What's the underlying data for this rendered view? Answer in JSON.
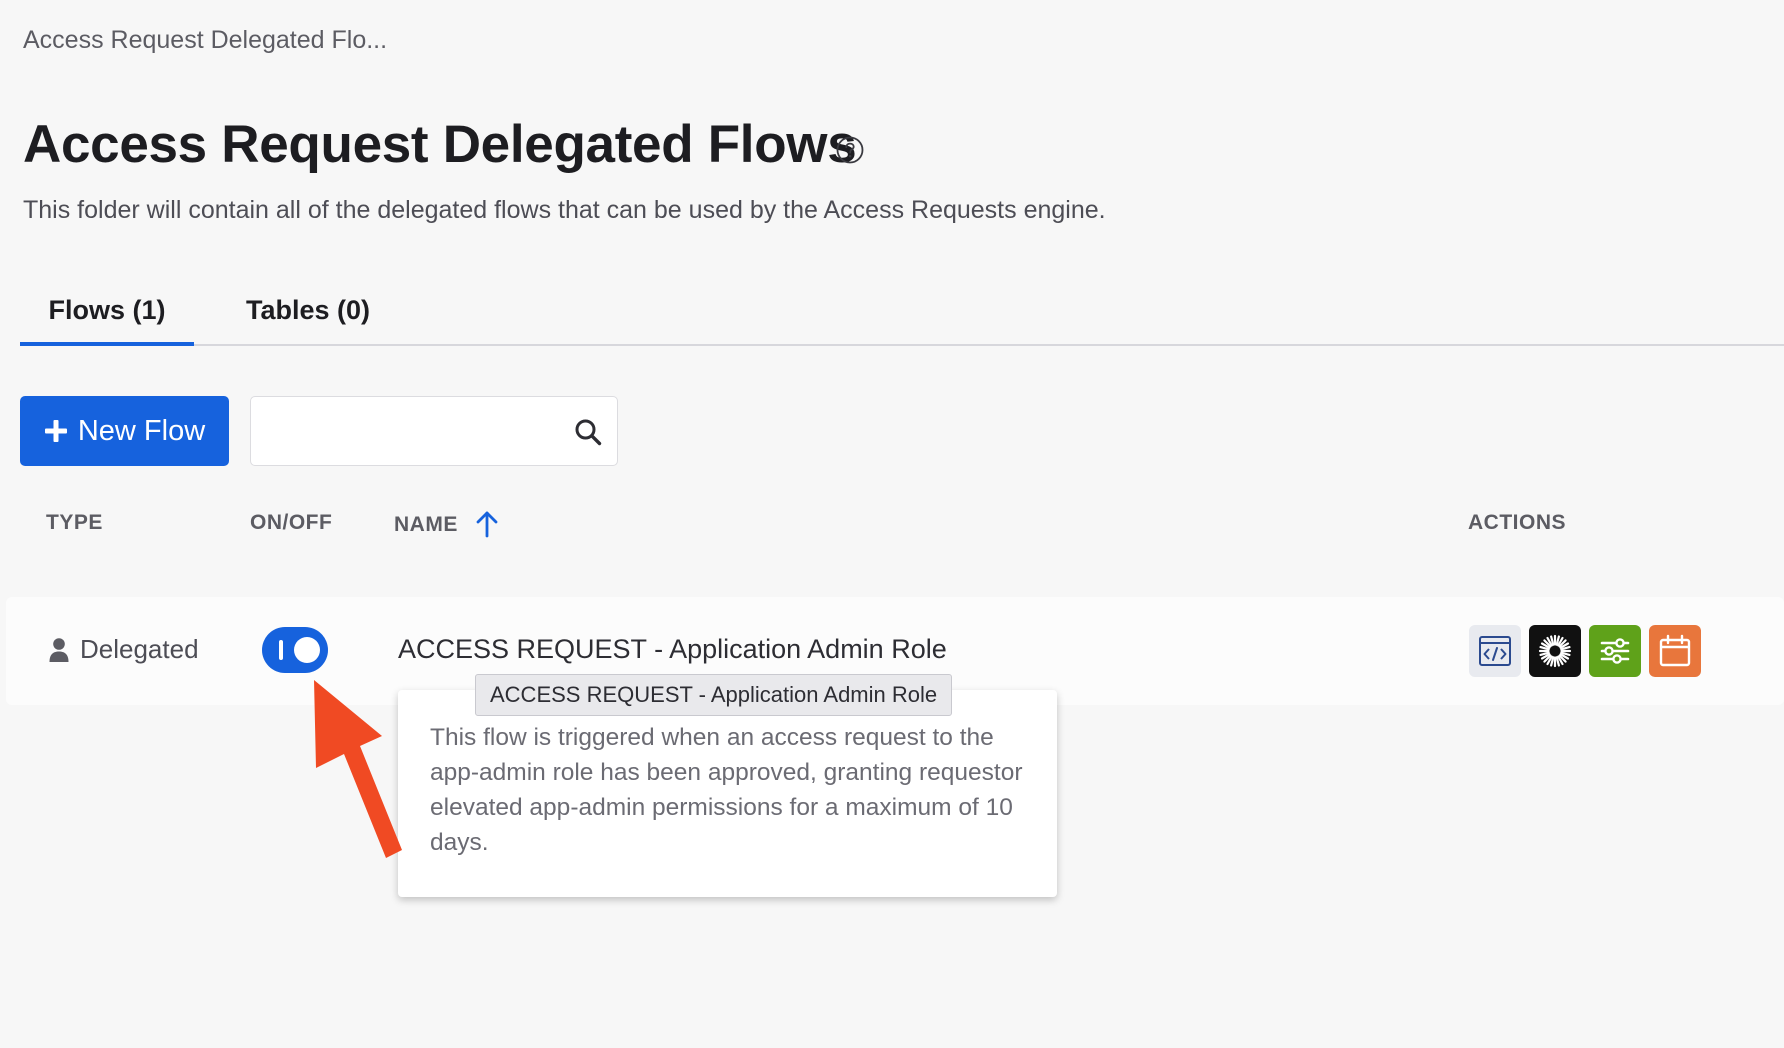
{
  "breadcrumb": "Access Request Delegated Flo...",
  "page": {
    "title": "Access Request Delegated Flows",
    "description": "This folder will contain all of the delegated flows that can be used by the Access Requests engine."
  },
  "tabs": [
    {
      "label": "Flows (1)",
      "active": true
    },
    {
      "label": "Tables (0)",
      "active": false
    }
  ],
  "toolbar": {
    "new_flow_label": "New Flow",
    "search_value": "",
    "search_placeholder": ""
  },
  "table": {
    "headers": {
      "type": "TYPE",
      "onoff": "ON/OFF",
      "name": "NAME",
      "actions": "ACTIONS"
    },
    "sort": {
      "column": "name",
      "direction": "ascending"
    },
    "rows": [
      {
        "type": "Delegated",
        "enabled": true,
        "name": "ACCESS REQUEST - Application Admin Role",
        "actions": [
          "code-icon",
          "okta-sunburst-icon",
          "settings-sliders-icon",
          "calendar-icon"
        ]
      }
    ]
  },
  "tooltip": {
    "title": "ACCESS REQUEST - Application Admin Role",
    "description": "This flow is triggered when an access request to the app-admin role has been approved, granting requestor elevated app-admin permissions for a maximum of 10 days."
  },
  "colors": {
    "primary": "#1662dd",
    "background": "#f7f7f7",
    "action_code_bg": "#e8eaef",
    "action_okta_bg": "#111111",
    "action_settings_bg": "#5fa21a",
    "action_schedule_bg": "#e8763c",
    "annotation_arrow": "#f04a23"
  }
}
